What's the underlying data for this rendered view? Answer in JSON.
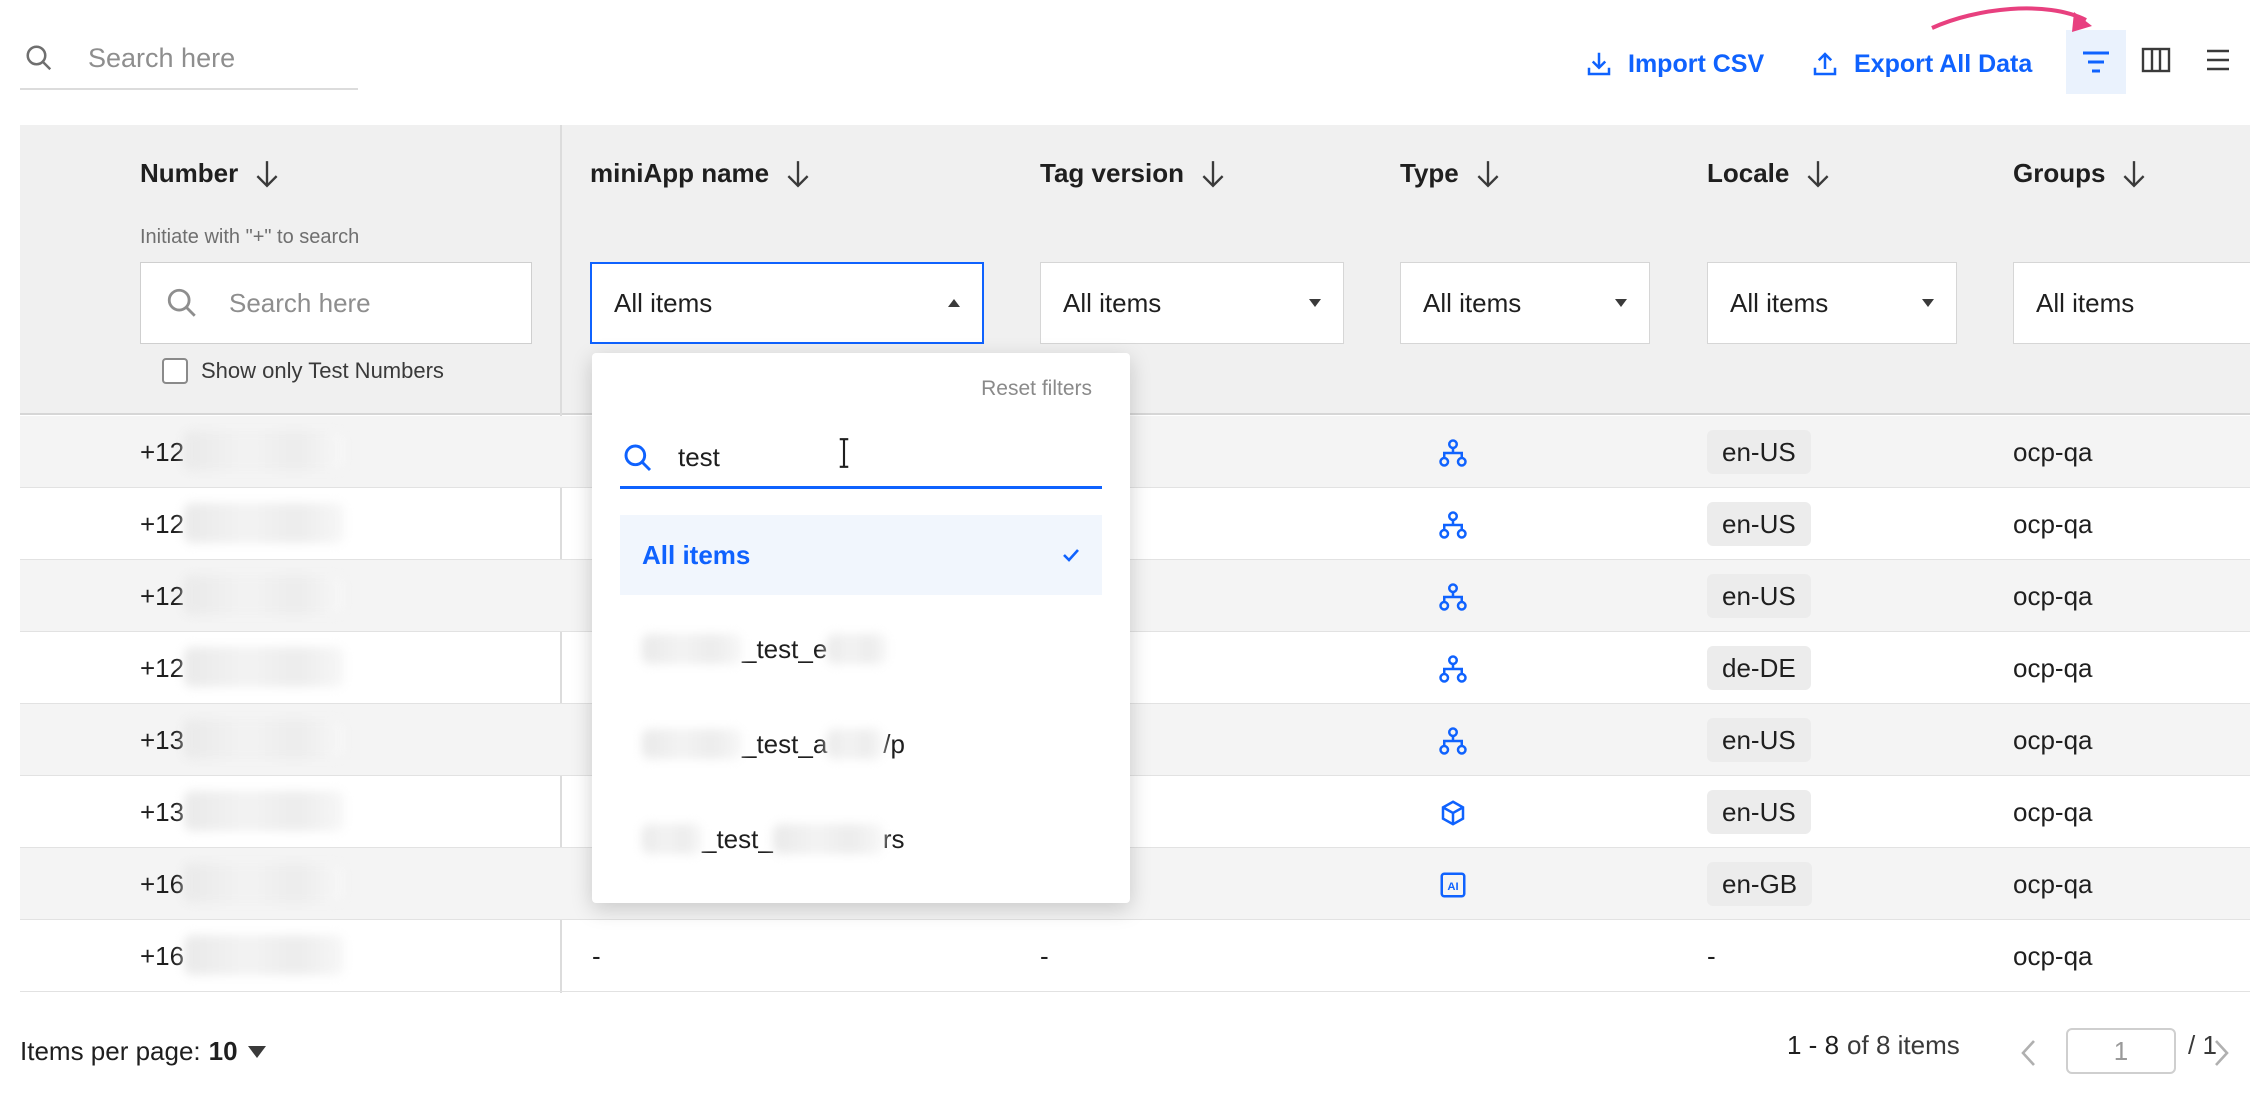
{
  "toolbar": {
    "search_placeholder": "Search here",
    "import_label": "Import CSV",
    "export_label": "Export All Data"
  },
  "columns": [
    {
      "label": "Number"
    },
    {
      "label": "miniApp name"
    },
    {
      "label": "Tag version"
    },
    {
      "label": "Type"
    },
    {
      "label": "Locale"
    },
    {
      "label": "Groups"
    }
  ],
  "number_filter": {
    "hint": "Initiate with \"+\" to search",
    "placeholder": "Search here",
    "test_numbers_label": "Show only Test Numbers"
  },
  "filters": {
    "miniapp": "All items",
    "tag_version": "All items",
    "type": "All items",
    "locale": "All items",
    "groups": "All items"
  },
  "dropdown": {
    "reset_label": "Reset filters",
    "search_value": "test",
    "selected_label": "All items",
    "options": [
      {
        "prefix": "",
        "text": "_test_e",
        "suffix": ""
      },
      {
        "prefix": "",
        "text": "_test_a",
        "suffix": "/p"
      },
      {
        "prefix": "",
        "text": "_test_",
        "suffix": "rs"
      }
    ]
  },
  "rows": [
    {
      "number_prefix": "+12",
      "miniapp": "",
      "tag": "",
      "type_icon": "flow-icon",
      "locale": "en-US",
      "group": "ocp-qa"
    },
    {
      "number_prefix": "+12",
      "miniapp": "",
      "tag": "",
      "type_icon": "flow-icon",
      "locale": "en-US",
      "group": "ocp-qa"
    },
    {
      "number_prefix": "+12",
      "miniapp": "",
      "tag": "",
      "type_icon": "flow-icon",
      "locale": "en-US",
      "group": "ocp-qa"
    },
    {
      "number_prefix": "+12",
      "miniapp": "",
      "tag": "",
      "type_icon": "flow-icon",
      "locale": "de-DE",
      "group": "ocp-qa"
    },
    {
      "number_prefix": "+13",
      "miniapp": "",
      "tag": "",
      "type_icon": "flow-icon",
      "locale": "en-US",
      "group": "ocp-qa"
    },
    {
      "number_prefix": "+13",
      "miniapp": "",
      "tag": "",
      "type_icon": "cube-icon",
      "locale": "en-US",
      "group": "ocp-qa"
    },
    {
      "number_prefix": "+16",
      "miniapp": "",
      "tag": "",
      "type_icon": "ai-icon",
      "locale": "en-GB",
      "group": "ocp-qa"
    },
    {
      "number_prefix": "+16",
      "miniapp": "-",
      "tag": "-",
      "type_icon": "",
      "locale": "-",
      "group": "ocp-qa"
    }
  ],
  "footer": {
    "items_per_page_label": "Items per page:",
    "items_per_page_value": "10",
    "range_label": "1 - 8",
    "of_label": "of 8 items",
    "page_value": "1",
    "page_total": "/ 1"
  },
  "colors": {
    "accent": "#0f62fe",
    "annotation_arrow": "#e8407f"
  }
}
